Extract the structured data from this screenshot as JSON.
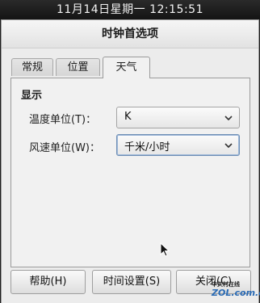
{
  "panel_clock": "11月14日星期一 12:15:51",
  "window": {
    "title": "时钟首选项"
  },
  "tabs": [
    {
      "label": "常规"
    },
    {
      "label": "位置"
    },
    {
      "label": "天气"
    }
  ],
  "display_section": {
    "title": "显示",
    "temperature": {
      "label": "温度单位(T)：",
      "value": "K"
    },
    "wind_speed": {
      "label": "风速单位(W)：",
      "value": "千米/小时"
    }
  },
  "buttons": {
    "help": "帮助(H)",
    "time_settings": "时间设置(S)",
    "close": "关闭(C)"
  },
  "watermark": {
    "line1": "中关村在线",
    "line2": "ZOL.com.cn"
  }
}
